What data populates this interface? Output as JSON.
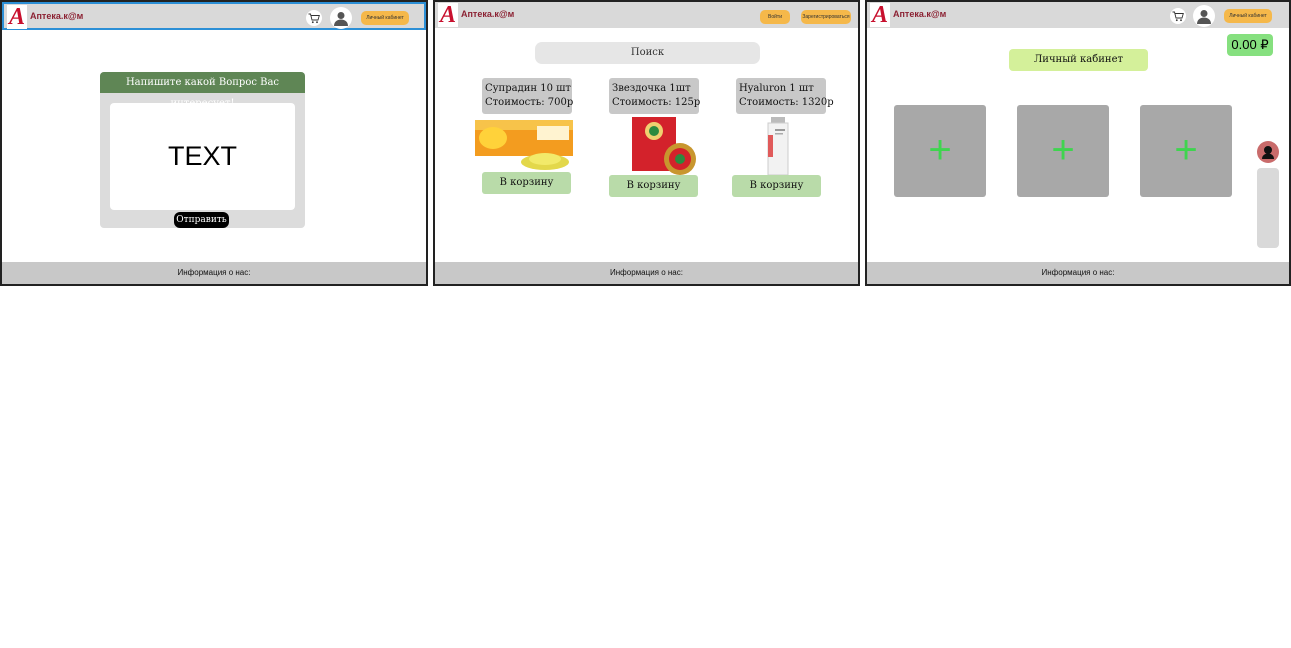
{
  "frames": [
    {
      "brand": "Аптека.к@м",
      "cabinet_btn": "Личный кабинет",
      "question_header": "Напишите какой Вопрос Вас интересует!",
      "question_text": "TEXT",
      "send_label": "Отправить",
      "footer": "Информация о нас:"
    },
    {
      "brand": "Аптека.к@м",
      "login_btn": "Войти",
      "register_btn": "Зарегистрироваться",
      "search_placeholder": "Поиск",
      "products": [
        {
          "name": "Супрадин 10 шт",
          "price": "Стоимость: 700р",
          "button": "В корзину"
        },
        {
          "name": "Звездочка 1шт",
          "price": "Стоимость: 125р",
          "button": "В корзину"
        },
        {
          "name": "Hyaluron 1 шт",
          "price": "Стоимость: 1320р",
          "button": "В корзину"
        }
      ],
      "footer": "Информация о нас:"
    },
    {
      "brand": "Аптека.к@м",
      "cabinet_btn": "Личный кабинет",
      "balance": "0.00 ₽",
      "cabinet_title": "Личный кабинет",
      "add_glyph": "+",
      "footer": "Информация о нас:"
    }
  ],
  "colors": {
    "header": "#d9d9d9",
    "brand_text": "#8c2233",
    "logo": "#c8102e",
    "accent_orange": "#f5b84a",
    "question_header": "#5f8655",
    "cart_button": "#b9dba9",
    "balance": "#86e07f",
    "cabinet_title": "#d4f09a",
    "plus": "#3fd44f",
    "footer": "#c8c8c8"
  },
  "icons": [
    "cart-icon",
    "user-avatar-icon"
  ]
}
